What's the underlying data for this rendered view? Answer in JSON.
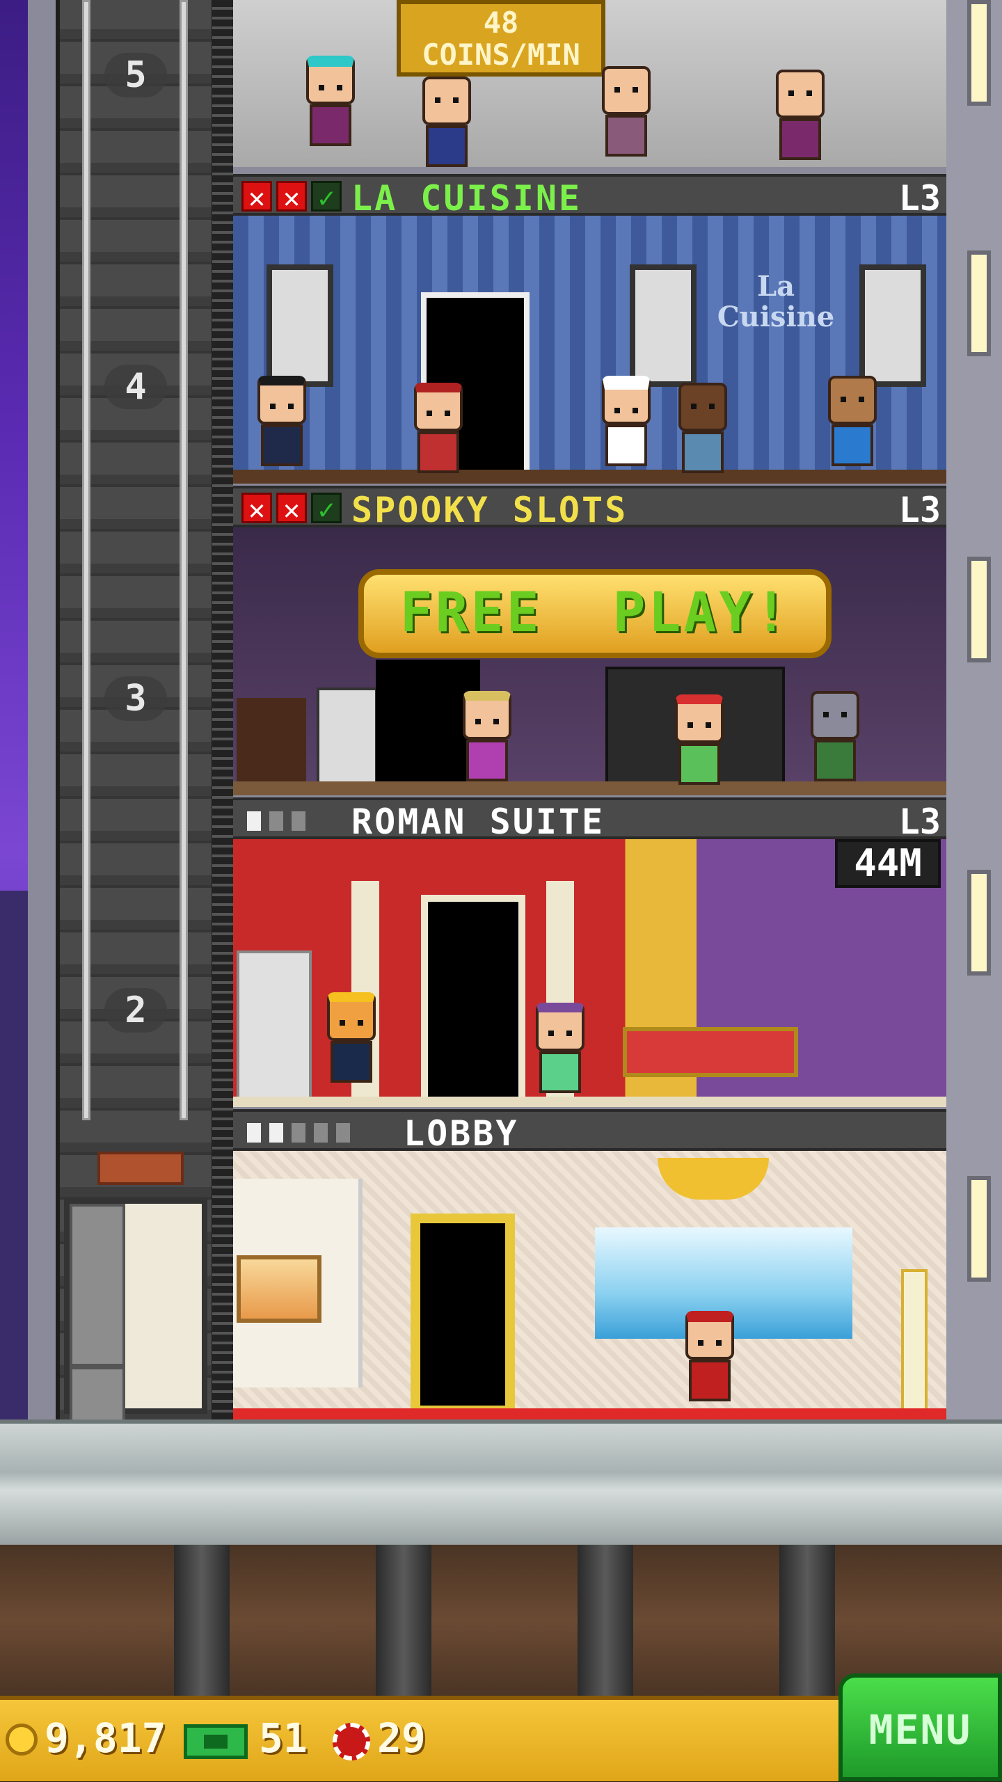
{
  "top_floor": {
    "floor_number": "5",
    "income_banner": "48\nCOINS/MIN"
  },
  "floors": [
    {
      "name": "LA CUISINE",
      "level": "L3",
      "floor_number": "4",
      "status": [
        "x",
        "x",
        "ok"
      ],
      "name_color": "#7cf04a",
      "sign_text": "La Cuisine"
    },
    {
      "name": "SPOOKY SLOTS",
      "level": "L3",
      "floor_number": "3",
      "status": [
        "x",
        "x",
        "ok"
      ],
      "name_color": "#f2e04a",
      "banner": "FREE  PLAY!"
    },
    {
      "name": "ROMAN SUITE",
      "level": "L3",
      "floor_number": "2",
      "occupancy": [
        1,
        0,
        0
      ],
      "name_color": "#ffffff",
      "timer": "44M"
    },
    {
      "name": "LOBBY",
      "floor_number": "",
      "occupancy": [
        1,
        1,
        0,
        0,
        0
      ],
      "name_color": "#ffffff"
    }
  ],
  "status_bar": {
    "coins": "9,817",
    "bux": "51",
    "chips": "29",
    "menu_label": "MENU"
  },
  "colors": {
    "coin": "#ffd23a",
    "bux": "#2eb84a",
    "chip": "#c81818",
    "menu": "#1e9a2a"
  }
}
